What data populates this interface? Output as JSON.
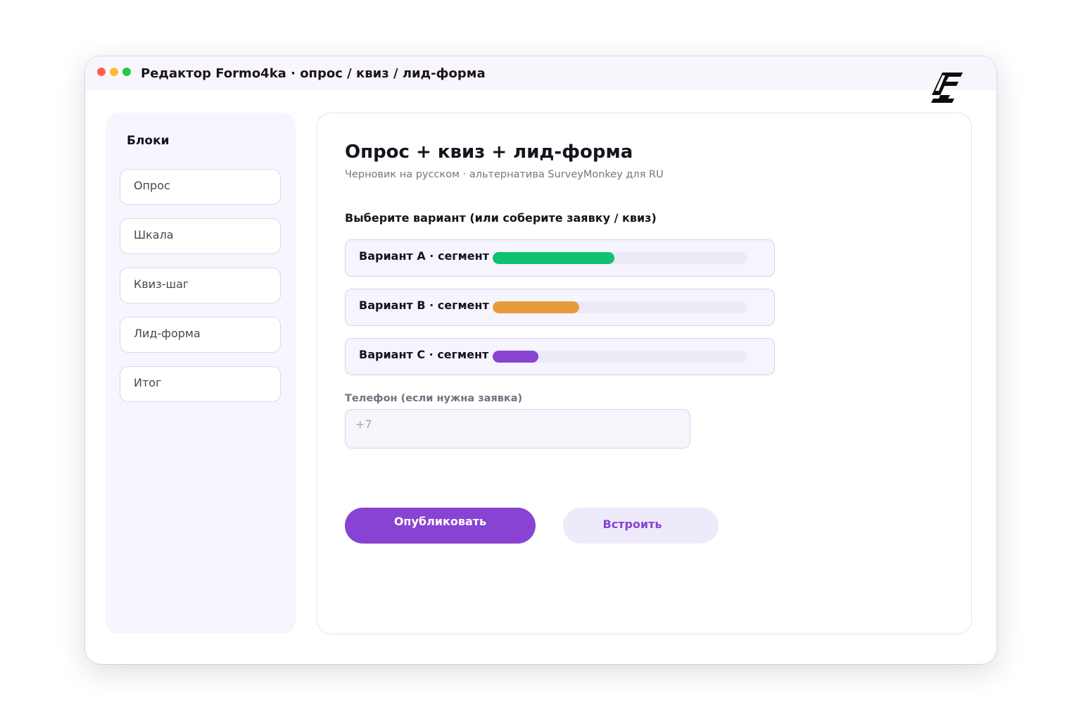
{
  "window": {
    "title": "Редактор Formo4ka · опрос / квиз / лид-форма"
  },
  "sidebar": {
    "heading": "Блоки",
    "items": [
      {
        "label": "Опрос"
      },
      {
        "label": "Шкала"
      },
      {
        "label": "Квиз-шаг"
      },
      {
        "label": "Лид-форма"
      },
      {
        "label": "Итог"
      }
    ]
  },
  "main": {
    "title": "Опрос + квиз + лид-форма",
    "subtitle": "Черновик на русском · альтернатива SurveyMonkey для RU",
    "question": "Выберите вариант (или соберите заявку / квиз)",
    "options": [
      {
        "label": "Вариант A · сегмент",
        "share": 0.48,
        "color": "#0fc170"
      },
      {
        "label": "Вариант B · сегмент",
        "share": 0.34,
        "color": "#e89b3c"
      },
      {
        "label": "Вариант C · сегмент",
        "share": 0.18,
        "color": "#8843d2"
      }
    ],
    "phone": {
      "label": "Телефон (если нужна заявка)",
      "placeholder": "+7",
      "value": ""
    },
    "publish_label": "Опубликовать",
    "embed_label": "Встроить"
  },
  "colors": {
    "accent": "#8843d2",
    "sidebar_bg": "#f7f5fd",
    "titlebar_bg": "#f8f6fc"
  },
  "icons": {
    "logo": "formo4ka-logo-icon"
  }
}
